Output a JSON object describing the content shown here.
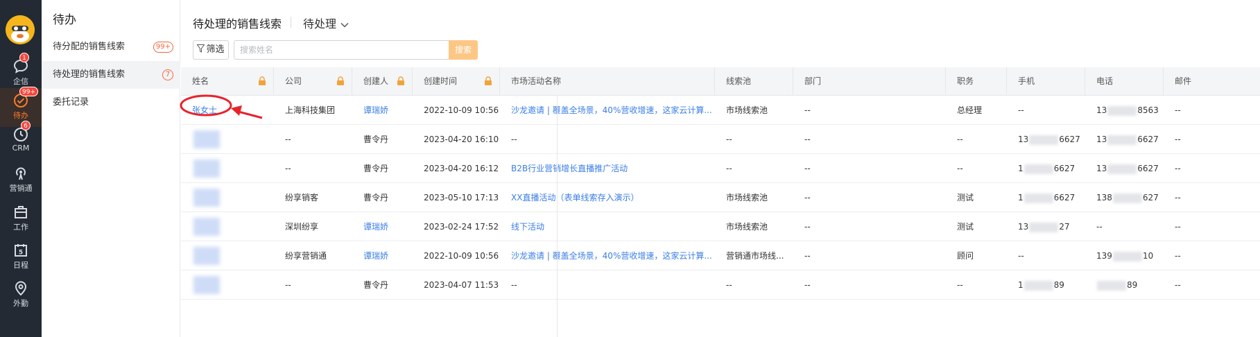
{
  "rail": {
    "items": [
      {
        "label": "企信",
        "icon": "chat-bubble-icon",
        "badge": "1"
      },
      {
        "label": "待办",
        "icon": "check-circle-icon",
        "badge": "99+"
      },
      {
        "label": "CRM",
        "icon": "clock-icon",
        "badge": "6"
      },
      {
        "label": "营销通",
        "icon": "broadcast-icon",
        "badge": ""
      },
      {
        "label": "工作",
        "icon": "briefcase-icon",
        "badge": ""
      },
      {
        "label": "日程",
        "icon": "calendar-icon",
        "badge": "",
        "day": "5"
      },
      {
        "label": "外勤",
        "icon": "location-pin-icon",
        "badge": ""
      }
    ]
  },
  "menu": {
    "title": "待办",
    "items": [
      {
        "label": "待分配的销售线索",
        "badge": "99+"
      },
      {
        "label": "待处理的销售线索",
        "badge": "7"
      },
      {
        "label": "委托记录",
        "badge": ""
      }
    ]
  },
  "header": {
    "title": "待处理的销售线索",
    "view": "待处理"
  },
  "toolbar": {
    "filter_label": "筛选",
    "search_placeholder": "搜索姓名",
    "search_label": "搜索"
  },
  "table": {
    "columns": [
      "姓名",
      "公司",
      "创建人",
      "创建时间",
      "市场活动名称",
      "线索池",
      "部门",
      "职务",
      "手机",
      "电话",
      "邮件"
    ],
    "rows": [
      {
        "name": "张女士",
        "company": "上海科技集团",
        "creator": "谭瑞娇",
        "created": "2022-10-09 10:56",
        "campaign": "沙龙邀请 | 覆盖全场景，40%营收增速，这家云计算...",
        "pool": "市场线索池",
        "dept": "--",
        "title": "总经理",
        "mobile": "--",
        "phone_prefix": "13",
        "phone_suffix": "8563",
        "email": "--"
      },
      {
        "name": "",
        "company": "--",
        "creator": "曹令丹",
        "created": "2023-04-20 16:10",
        "campaign": "--",
        "pool": "--",
        "dept": "--",
        "title": "--",
        "mobile_prefix": "13",
        "mobile_suffix": "6627",
        "phone_prefix": "13",
        "phone_suffix": "6627",
        "email": "--"
      },
      {
        "name": "",
        "company": "--",
        "creator": "曹令丹",
        "created": "2023-04-20 16:12",
        "campaign": "B2B行业营销增长直播推广活动",
        "pool": "--",
        "dept": "--",
        "title": "--",
        "mobile_prefix": "1",
        "mobile_suffix": "6627",
        "phone_prefix": "13",
        "phone_suffix": "6627",
        "email": "--"
      },
      {
        "name": "",
        "company": "纷享销客",
        "creator": "曹令丹",
        "created": "2023-05-10 17:13",
        "campaign": "XX直播活动（表单线索存入演示）",
        "pool": "市场线索池",
        "dept": "--",
        "title": "测试",
        "mobile_prefix": "1",
        "mobile_suffix": "6627",
        "phone_prefix": "138",
        "phone_suffix": "627",
        "email": "--"
      },
      {
        "name": "",
        "company": "深圳纷享",
        "creator": "谭瑞娇",
        "created": "2023-02-24 17:52",
        "campaign": "线下活动",
        "pool": "市场线索池",
        "dept": "--",
        "title": "测试",
        "mobile_prefix": "13",
        "mobile_suffix": "27",
        "phone_prefix": "",
        "phone_suffix": "",
        "phone": "--",
        "email": "--"
      },
      {
        "name": "",
        "company": "纷享营销通",
        "creator": "谭瑞娇",
        "created": "2022-10-09 10:56",
        "campaign": "沙龙邀请 | 覆盖全场景，40%营收增速，这家云计算...",
        "pool": "营销通市场线...",
        "dept": "--",
        "title": "顾问",
        "mobile": "--",
        "phone_prefix": "139",
        "phone_suffix": "10",
        "email": "--"
      },
      {
        "name": "",
        "company": "--",
        "creator": "曹令丹",
        "created": "2023-04-07 11:53",
        "campaign": "--",
        "pool": "--",
        "dept": "--",
        "title": "--",
        "mobile_prefix": "1",
        "mobile_suffix": "89",
        "phone_prefix": "",
        "phone_suffix": "89",
        "email": "--"
      }
    ]
  },
  "colors": {
    "rail_bg": "#242a33",
    "accent": "#ff7a2b",
    "link": "#3a7ee6",
    "badge": "#f5463b",
    "annotation": "#e8222b"
  }
}
